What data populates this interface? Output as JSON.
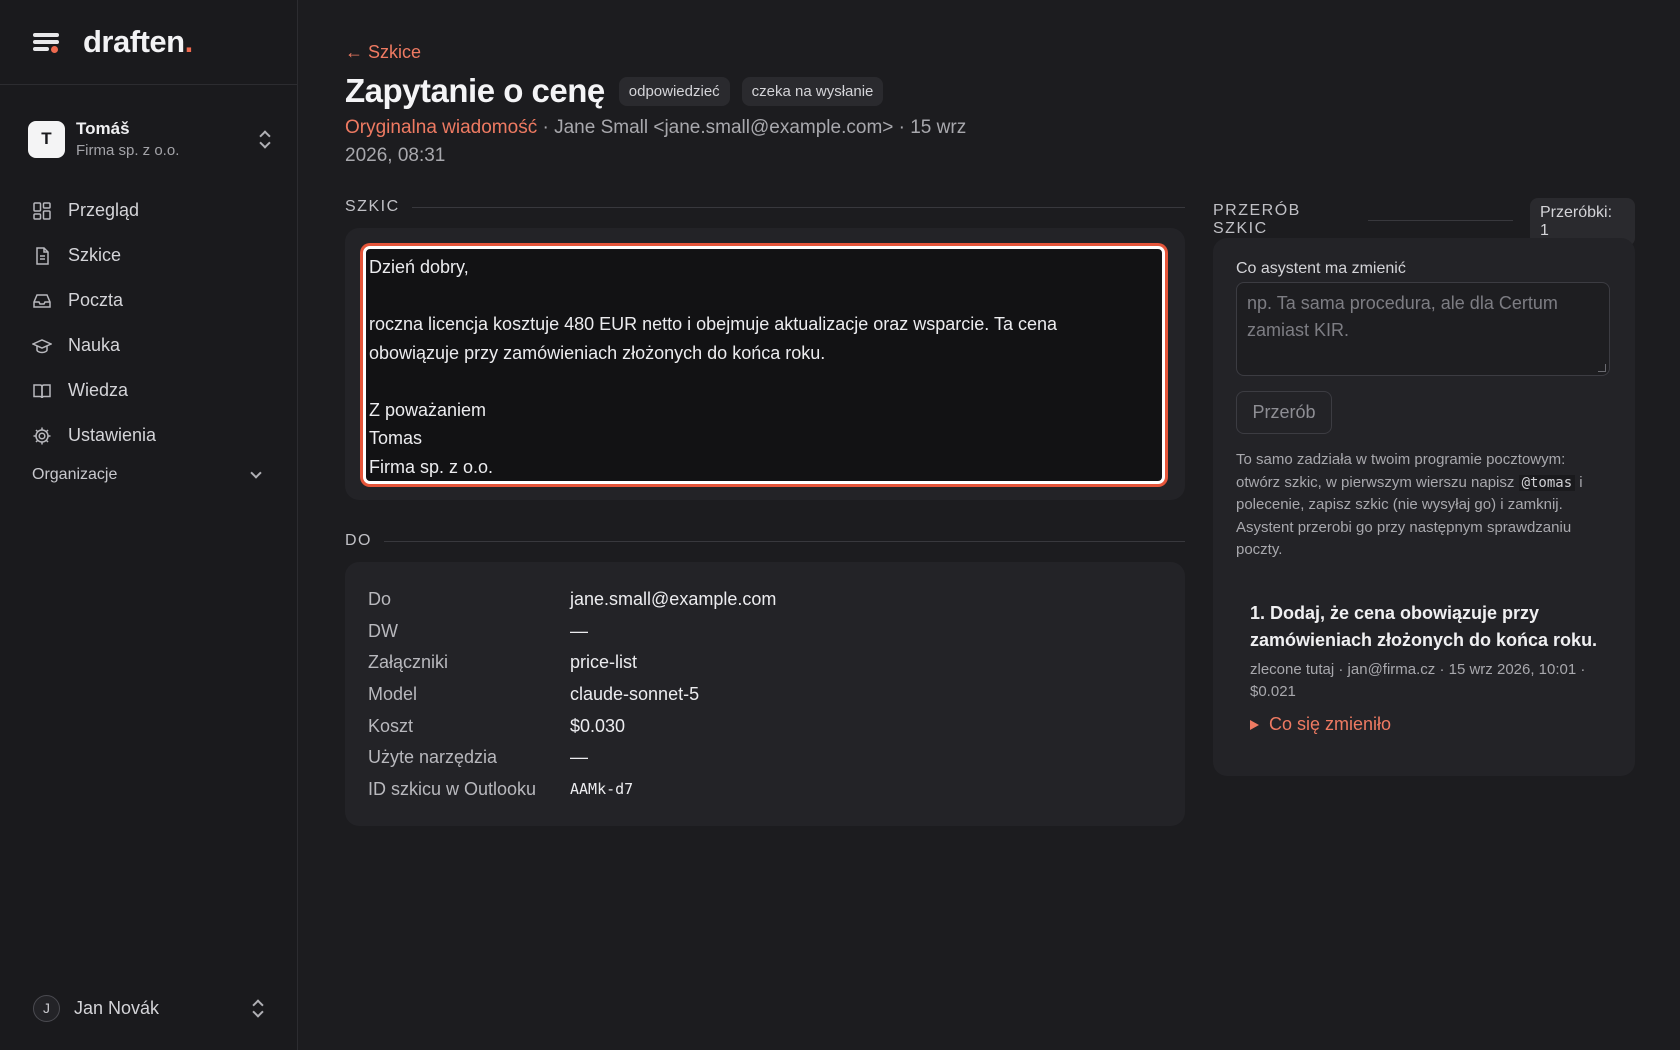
{
  "brand": {
    "name": "draften",
    "dot": "."
  },
  "account": {
    "initial": "T",
    "name": "Tomáš",
    "org": "Firma sp. z o.o."
  },
  "nav": [
    {
      "label": "Przegląd",
      "icon": "dashboard-icon"
    },
    {
      "label": "Szkice",
      "icon": "document-icon"
    },
    {
      "label": "Poczta",
      "icon": "inbox-icon"
    },
    {
      "label": "Nauka",
      "icon": "graduation-cap-icon"
    },
    {
      "label": "Wiedza",
      "icon": "book-icon"
    },
    {
      "label": "Ustawienia",
      "icon": "gear-icon"
    }
  ],
  "organizations_label": "Organizacje",
  "user": {
    "initial": "J",
    "name": "Jan Novák"
  },
  "header": {
    "back_label": "← Szkice",
    "title": "Zapytanie o cenę",
    "badges": [
      "odpowiedzieć",
      "czeka na wysłanie"
    ],
    "original_link": "Oryginalna wiadomość",
    "meta_rest": " · Jane Small <jane.small@example.com> · 15 wrz 2026, 08:31"
  },
  "draft": {
    "section_label": "SZKIC",
    "lines": [
      "Dzień dobry,",
      "",
      "roczna licencja kosztuje 480 EUR netto i obejmuje aktualizacje oraz wsparcie. Ta cena",
      "obowiązuje przy zamówieniach złożonych do końca roku.",
      "",
      "Z poważaniem",
      "Tomas",
      "Firma sp. z o.o."
    ]
  },
  "details": {
    "section_label": "DO",
    "rows": [
      {
        "key": "Do",
        "value": "jane.small@example.com"
      },
      {
        "key": "DW",
        "value": "—"
      },
      {
        "key": "Załączniki",
        "value": "price-list"
      },
      {
        "key": "Model",
        "value": "claude-sonnet-5"
      },
      {
        "key": "Koszt",
        "value": "$0.030"
      },
      {
        "key": "Użyte narzędzia",
        "value": "—"
      },
      {
        "key": "ID szkicu w Outlooku",
        "value": "AAMk-d7"
      }
    ]
  },
  "rework": {
    "section_label": "PRZERÓB SZKIC",
    "counter": "Przeróbki: 1",
    "field_label": "Co asystent ma zmienić",
    "placeholder": "np. Ta sama procedura, ale dla Certum zamiast KIR.",
    "button_label": "Przerób",
    "help_before": "To samo zadziała w twoim programie pocztowym: otwórz szkic, w pierwszym wierszu napisz ",
    "help_code": "@tomas",
    "help_after": " i polecenie, zapisz szkic (nie wysyłaj go) i zamknij. Asystent przerobi go przy następnym sprawdzaniu poczty.",
    "history": {
      "title": "1. Dodaj, że cena obowiązuje przy zamówieniach złożonych do końca roku.",
      "meta": "zlecone tutaj · jan@firma.cz · 15 wrz 2026, 10:01 · $0.021",
      "toggle": "Co się zmieniło"
    }
  },
  "colors": {
    "accent": "#ee7a62",
    "focus_ring": "#e5553a",
    "background": "#1c1c1f",
    "card": "#232327"
  }
}
